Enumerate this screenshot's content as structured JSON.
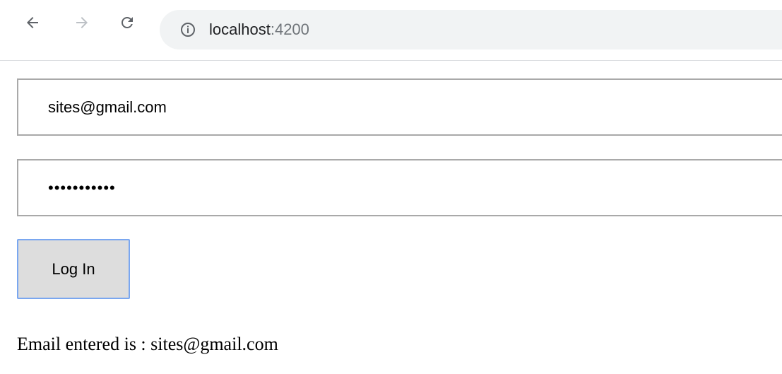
{
  "browser": {
    "url_host": "localhost",
    "url_port": ":4200",
    "icons": {
      "back": "back-arrow-icon",
      "forward": "forward-arrow-icon",
      "reload": "reload-icon",
      "info": "info-icon"
    }
  },
  "form": {
    "email_value": "sites@gmail.com",
    "password_masked": "•••••••••••",
    "login_label": "Log In"
  },
  "output": {
    "status_text": "Email entered is : sites@gmail.com"
  },
  "colors": {
    "omnibox_bg": "#f1f3f4",
    "button_bg": "#dddddd",
    "button_focus_border": "#7aa7f0",
    "field_border": "#a9a9a9"
  }
}
